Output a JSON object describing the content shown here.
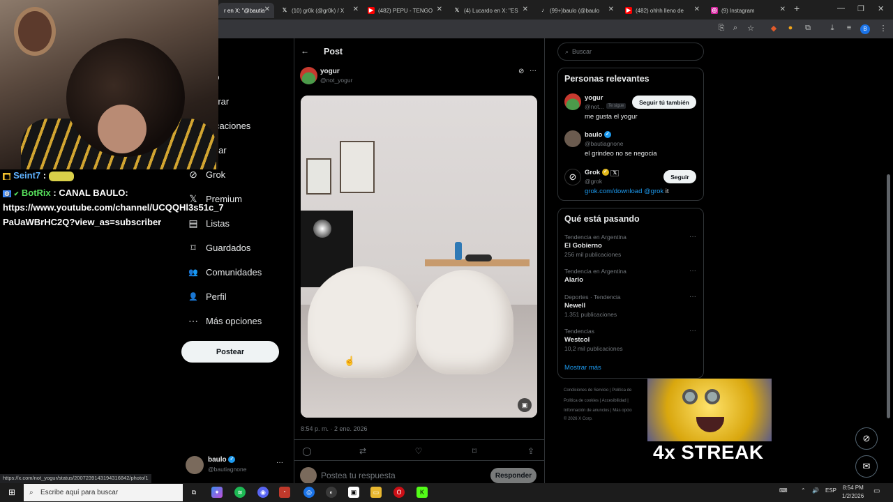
{
  "browser": {
    "tabs": [
      {
        "label": "r en X: \"@bautia",
        "icon": "x-logo-icon",
        "active": true
      },
      {
        "label": "(10) gr0k (@gr0k) / X",
        "icon": "x-logo-icon",
        "active": false
      },
      {
        "label": "(482) PEPU - TENGO",
        "icon": "youtube-icon",
        "active": false
      },
      {
        "label": "(4) Lucardo en X: \"ES",
        "icon": "x-logo-icon",
        "active": false
      },
      {
        "label": "(99+)baulo (@baulo",
        "icon": "tiktok-icon",
        "active": false
      },
      {
        "label": "(482) ohhh lleno de",
        "icon": "youtube-icon",
        "active": false
      },
      {
        "label": "(9) Instagram",
        "icon": "instagram-icon",
        "active": false
      }
    ],
    "new_tab": "+",
    "profile_initial": "B",
    "status_url": "https://x.com/not_yogur/status/2007239143194316842/photo/1"
  },
  "chat": [
    {
      "user": "Seint7",
      "text": " :",
      "user_color": "#5fb2ff"
    },
    {
      "user": "BotRix",
      "text": " : CANAL BAULO:",
      "user_color": "#57e35c"
    },
    {
      "user": "",
      "text": "https://www.youtube.com/channel/UCQQHl3s51c_7",
      "user_color": "#ffffff"
    },
    {
      "user": "",
      "text": "PaUaWBrHC2Q?view_as=subscriber",
      "user_color": "#ffffff"
    }
  ],
  "nav": {
    "items": [
      {
        "label": "icio",
        "icon": "home-icon"
      },
      {
        "label": "plorar",
        "icon": "search-icon"
      },
      {
        "label": "tificaciones",
        "icon": "bell-icon"
      },
      {
        "label": "atear",
        "icon": "mail-icon"
      },
      {
        "label": "Grok",
        "icon": "grok-icon",
        "glyph": "⊘"
      },
      {
        "label": "Premium",
        "icon": "x-premium-icon",
        "glyph": "𝕏"
      },
      {
        "label": "Listas",
        "icon": "list-icon",
        "glyph": "▤"
      },
      {
        "label": "Guardados",
        "icon": "bookmark-icon",
        "glyph": "⌑"
      },
      {
        "label": "Comunidades",
        "icon": "communities-icon",
        "glyph": "👥"
      },
      {
        "label": "Perfil",
        "icon": "profile-icon",
        "glyph": "👤"
      },
      {
        "label": "Más opciones",
        "icon": "more-circle-icon",
        "glyph": "⋯"
      }
    ],
    "post_button": "Postear",
    "account": {
      "name": "baulo",
      "handle": "@bautiagnone",
      "more": "···"
    }
  },
  "post": {
    "header_title": "Post",
    "back": "←",
    "author_name": "yogur",
    "author_handle": "@not_yogur",
    "timestamp": "8:54 p. m. · 2 ene. 2026",
    "reply_placeholder": "Postea tu respuesta",
    "reply_button": "Responder",
    "actions": [
      "reply-icon",
      "repost-icon",
      "like-icon",
      "bookmark-icon",
      "share-icon"
    ]
  },
  "sidebar": {
    "search_placeholder": "Buscar",
    "relevant": {
      "title": "Personas relevantes",
      "people": [
        {
          "name": "yogur",
          "handle": "@not...",
          "badge": "Te sigue",
          "bio": "me gusta el yogur",
          "button": "Seguir tú también"
        },
        {
          "name": "baulo",
          "handle": "@bautiagnone",
          "bio": "el grindeo no se negocia",
          "button": ""
        },
        {
          "name": "Grok",
          "handle": "@grok",
          "bio_link": "grok.com/download",
          "bio_mention": "@grok",
          "bio_tail": " it",
          "button": "Seguir"
        }
      ]
    },
    "trends": {
      "title": "Qué está pasando",
      "items": [
        {
          "context": "Tendencia en Argentina",
          "name": "El Gobierno",
          "count": "256 mil publicaciones"
        },
        {
          "context": "Tendencia en Argentina",
          "name": "Alario",
          "count": ""
        },
        {
          "context": "Deportes · Tendencia",
          "name": "Newell",
          "count": "1.351 publicaciones"
        },
        {
          "context": "Tendencias",
          "name": "Westcol",
          "count": "10,2 mil publicaciones"
        }
      ],
      "show_more": "Mostrar más"
    },
    "footer": [
      "Condiciones de Servicio  |  Política de",
      "Política de cookies  |  Accesibilidad  |",
      "Información de anuncios  |  Más opcio",
      "© 2026 X Corp."
    ]
  },
  "overlay": {
    "streak_text": "4x STREAK"
  },
  "taskbar": {
    "search_placeholder": "Escribe aquí para buscar",
    "time": "8:54 PM",
    "date": "1/2/2026",
    "lang": "ESP"
  }
}
